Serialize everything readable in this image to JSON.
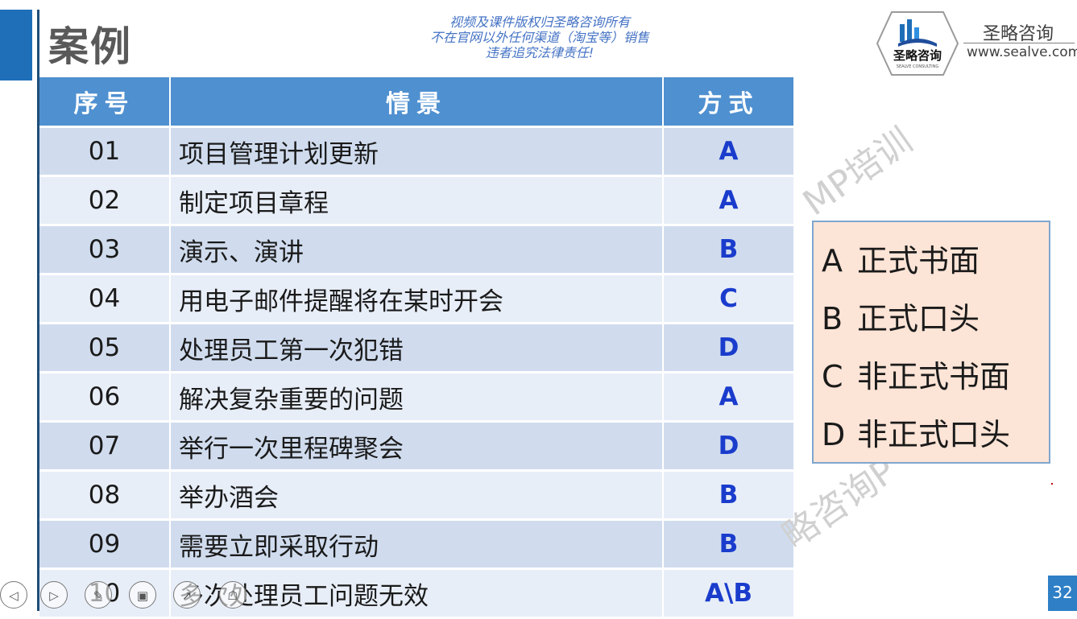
{
  "slide": {
    "title": "案例",
    "copyright": [
      "视频及课件版权归圣略咨询所有",
      "不在官网以外任何渠道（淘宝等）销售",
      "违者追究法律责任!"
    ],
    "brand": {
      "name": "圣略咨询",
      "url": "www.sealve.com",
      "logo_text": "圣略咨询",
      "logo_subtext": "SEALVE CONSULTING"
    },
    "watermarks": [
      "MP培训",
      "略咨询P"
    ],
    "page_number": "32"
  },
  "table": {
    "headers": [
      "序号",
      "情景",
      "方式"
    ],
    "rows": [
      {
        "num": "01",
        "scene": "项目管理计划更新",
        "mode": "A"
      },
      {
        "num": "02",
        "scene": "制定项目章程",
        "mode": "A"
      },
      {
        "num": "03",
        "scene": "演示、演讲",
        "mode": "B"
      },
      {
        "num": "04",
        "scene": "用电子邮件提醒将在某时开会",
        "mode": "C"
      },
      {
        "num": "05",
        "scene": "处理员工第一次犯错",
        "mode": "D"
      },
      {
        "num": "06",
        "scene": "解决复杂重要的问题",
        "mode": "A"
      },
      {
        "num": "07",
        "scene": "举行一次里程碑聚会",
        "mode": "D"
      },
      {
        "num": "08",
        "scene": "举办酒会",
        "mode": "B"
      },
      {
        "num": "09",
        "scene": "需要立即采取行动",
        "mode": "B"
      },
      {
        "num": "10",
        "scene": "多次处理员工问题无效",
        "mode": "A\\B"
      }
    ]
  },
  "legend": [
    {
      "letter": "A",
      "text": "正式书面"
    },
    {
      "letter": "B",
      "text": "正式口头"
    },
    {
      "letter": "C",
      "text": "非正式书面"
    },
    {
      "letter": "D",
      "text": "非正式口头"
    }
  ],
  "controls": [
    {
      "icon": "previous-icon",
      "glyph": "◁"
    },
    {
      "icon": "next-icon",
      "glyph": "▷"
    },
    {
      "icon": "pen-icon",
      "glyph": "✎"
    },
    {
      "icon": "slides-icon",
      "glyph": "▣"
    },
    {
      "icon": "pointer-icon",
      "glyph": "↗"
    },
    {
      "icon": "presenter-icon",
      "glyph": "☖"
    }
  ],
  "colors": {
    "header_blue": "#4f90d0",
    "mode_blue": "#1a3ccc",
    "legend_bg": "#fce4d6",
    "accent": "#1f6fb8"
  }
}
